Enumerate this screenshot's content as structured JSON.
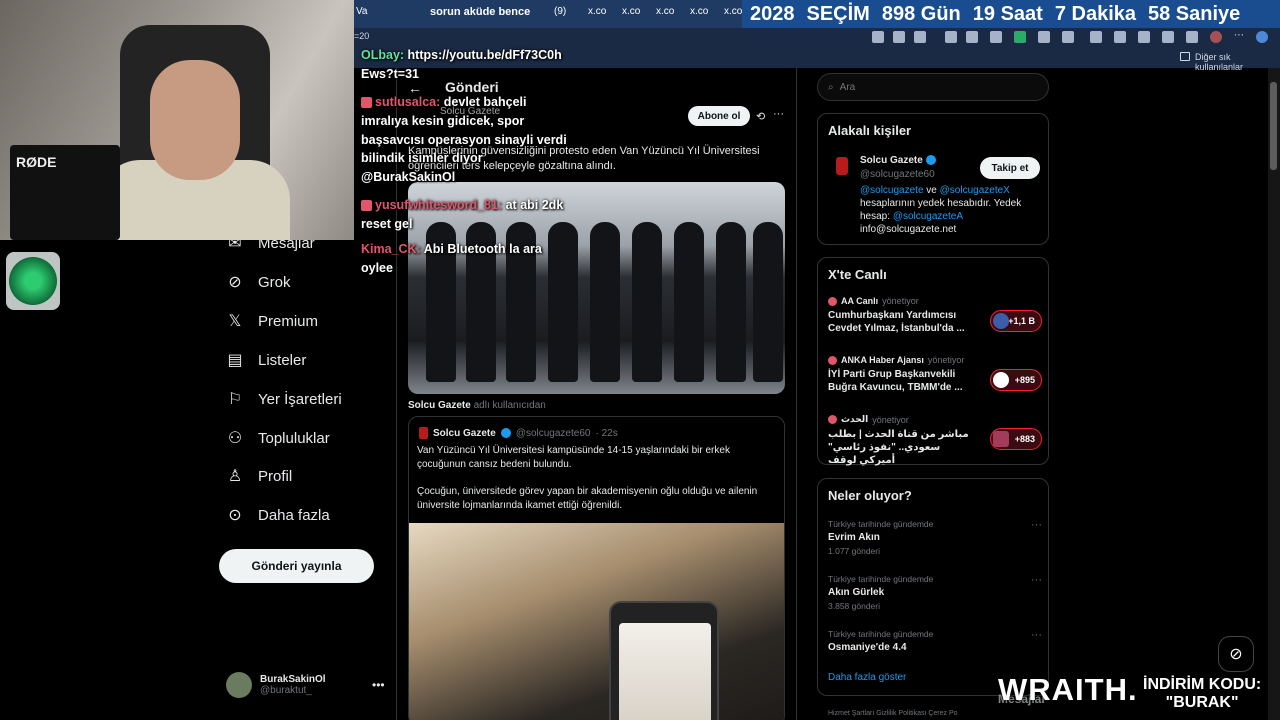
{
  "browser": {
    "tabs": [
      "Va",
      "sorun aküde bence",
      "(9)",
      "x.co",
      "x.co",
      "x.co",
      "x.co",
      "x.co"
    ],
    "url_fragment": "=20",
    "bookmarks_label": "Diğer sık kullanılanlar"
  },
  "countdown": {
    "year": "2028",
    "event": "SEÇİM",
    "days": "898 Gün",
    "hours": "19 Saat",
    "minutes": "7 Dakika",
    "seconds": "58 Saniye"
  },
  "webcam": {
    "mic_brand": "RØDE"
  },
  "chat": [
    {
      "name": "OLbay:",
      "text": "https://youtu.be/dFf73C0h"
    },
    {
      "name": "",
      "text": "Ews?t=31"
    },
    {
      "name": "sutlusalca:",
      "text": "devlet bahçeli"
    },
    {
      "name": "",
      "text": "imralıya kesin gidicek, spor"
    },
    {
      "name": "",
      "text": "başsavcısı operasyon sinayli verdi"
    },
    {
      "name": "",
      "text": "bilindik isimler diyor"
    },
    {
      "name": "",
      "text": "@BurakSakinOl"
    },
    {
      "name": "yusufwhitesword_81:",
      "text": "at abi 2dk"
    },
    {
      "name": "",
      "text": "reset gel"
    },
    {
      "name": "Kima_CK:",
      "text": "Abi Bluetooth la ara"
    },
    {
      "name": "",
      "text": "oylee"
    }
  ],
  "nav": {
    "items": [
      "Mesajlar",
      "Grok",
      "Premium",
      "Listeler",
      "Yer İşaretleri",
      "Topluluklar",
      "Profil",
      "Daha fazla"
    ],
    "post_button": "Gönderi yayınla",
    "user": {
      "name": "BurakSakinOl",
      "handle": "@buraktut_"
    }
  },
  "main": {
    "title": "Gönderi",
    "author": "Solcu Gazete",
    "subscribe": "Abone ol",
    "tweet_text": "Kampüslerinin güvensizliğini protesto eden Van Yüzüncü Yıl Üniversitesi öğrencileri ters kelepçeyle gözaltına alındı.",
    "quote_meta_name": "Solcu Gazete",
    "quote_meta_suffix": "adlı kullanıcıdan",
    "quote": {
      "name": "Solcu Gazete",
      "handle": "@solcugazete60",
      "time": "· 22s",
      "text1": "Van Yüzüncü Yıl Üniversitesi kampüsünde 14-15 yaşlarındaki bir erkek çocuğunun cansız bedeni bulundu.",
      "text2": "Çocuğun, üniversitede görev yapan bir akademisyenin oğlu olduğu ve ailenin üniversite lojmanlarında ikamet ettiği öğrenildi."
    }
  },
  "right": {
    "search_placeholder": "Ara",
    "related": {
      "title": "Alakalı kişiler",
      "name": "Solcu Gazete",
      "handle": "@solcugazete60",
      "follow": "Takip et",
      "bio_link1": "@solcugazete",
      "bio_and": " ve ",
      "bio_link2": "@solcugazeteX",
      "bio_mid": " hesaplarının yedek hesabıdır. Yedek hesap: ",
      "bio_link3": "@solcugazeteA",
      "bio_email": "info@solcugazete.net"
    },
    "live": {
      "title": "X'te Canlı",
      "items": [
        {
          "source": "AA Canlı",
          "role": "yönetiyor",
          "text": "Cumhurbaşkanı Yardımcısı Cevdet Yılmaz, İstanbul'da ...",
          "count": "+1,1 B"
        },
        {
          "source": "ANKA Haber Ajansı",
          "role": "yönetiyor",
          "text": "İYİ Parti Grup Başkanvekili Buğra Kavuncu, TBMM'de ...",
          "count": "+895"
        },
        {
          "source": "الحدث",
          "role": "yönetiyor",
          "text": "مباشر من قناة الحدث | بطلب سعودي.. \"نفوذ رئاسي\" أميركي لوقف",
          "count": "+883"
        }
      ]
    },
    "trends": {
      "title": "Neler oluyor?",
      "items": [
        {
          "meta": "Türkiye tarihinde gündemde",
          "name": "Evrim Akın",
          "count": "1.077 gönderi"
        },
        {
          "meta": "Türkiye tarihinde gündemde",
          "name": "Akın Gürlek",
          "count": "3.858 gönderi"
        },
        {
          "meta": "Türkiye tarihinde gündemde",
          "name": "Osmaniye'de 4.4",
          "count": ""
        }
      ],
      "show_more": "Daha fazla göster"
    },
    "footer": "Hizmet Şartları    Gizlilik Politikası    Çerez Po"
  },
  "overlay": {
    "sponsor": "WRAITH.",
    "promo_line1": "İNDİRİM KODU:",
    "promo_line2": "\"BURAK\"",
    "messages": "Mesajlar"
  },
  "colors": {
    "accent": "#1d9bf0",
    "chat_name": "#e0566b",
    "countdown_bg": "#1a4d8f"
  }
}
